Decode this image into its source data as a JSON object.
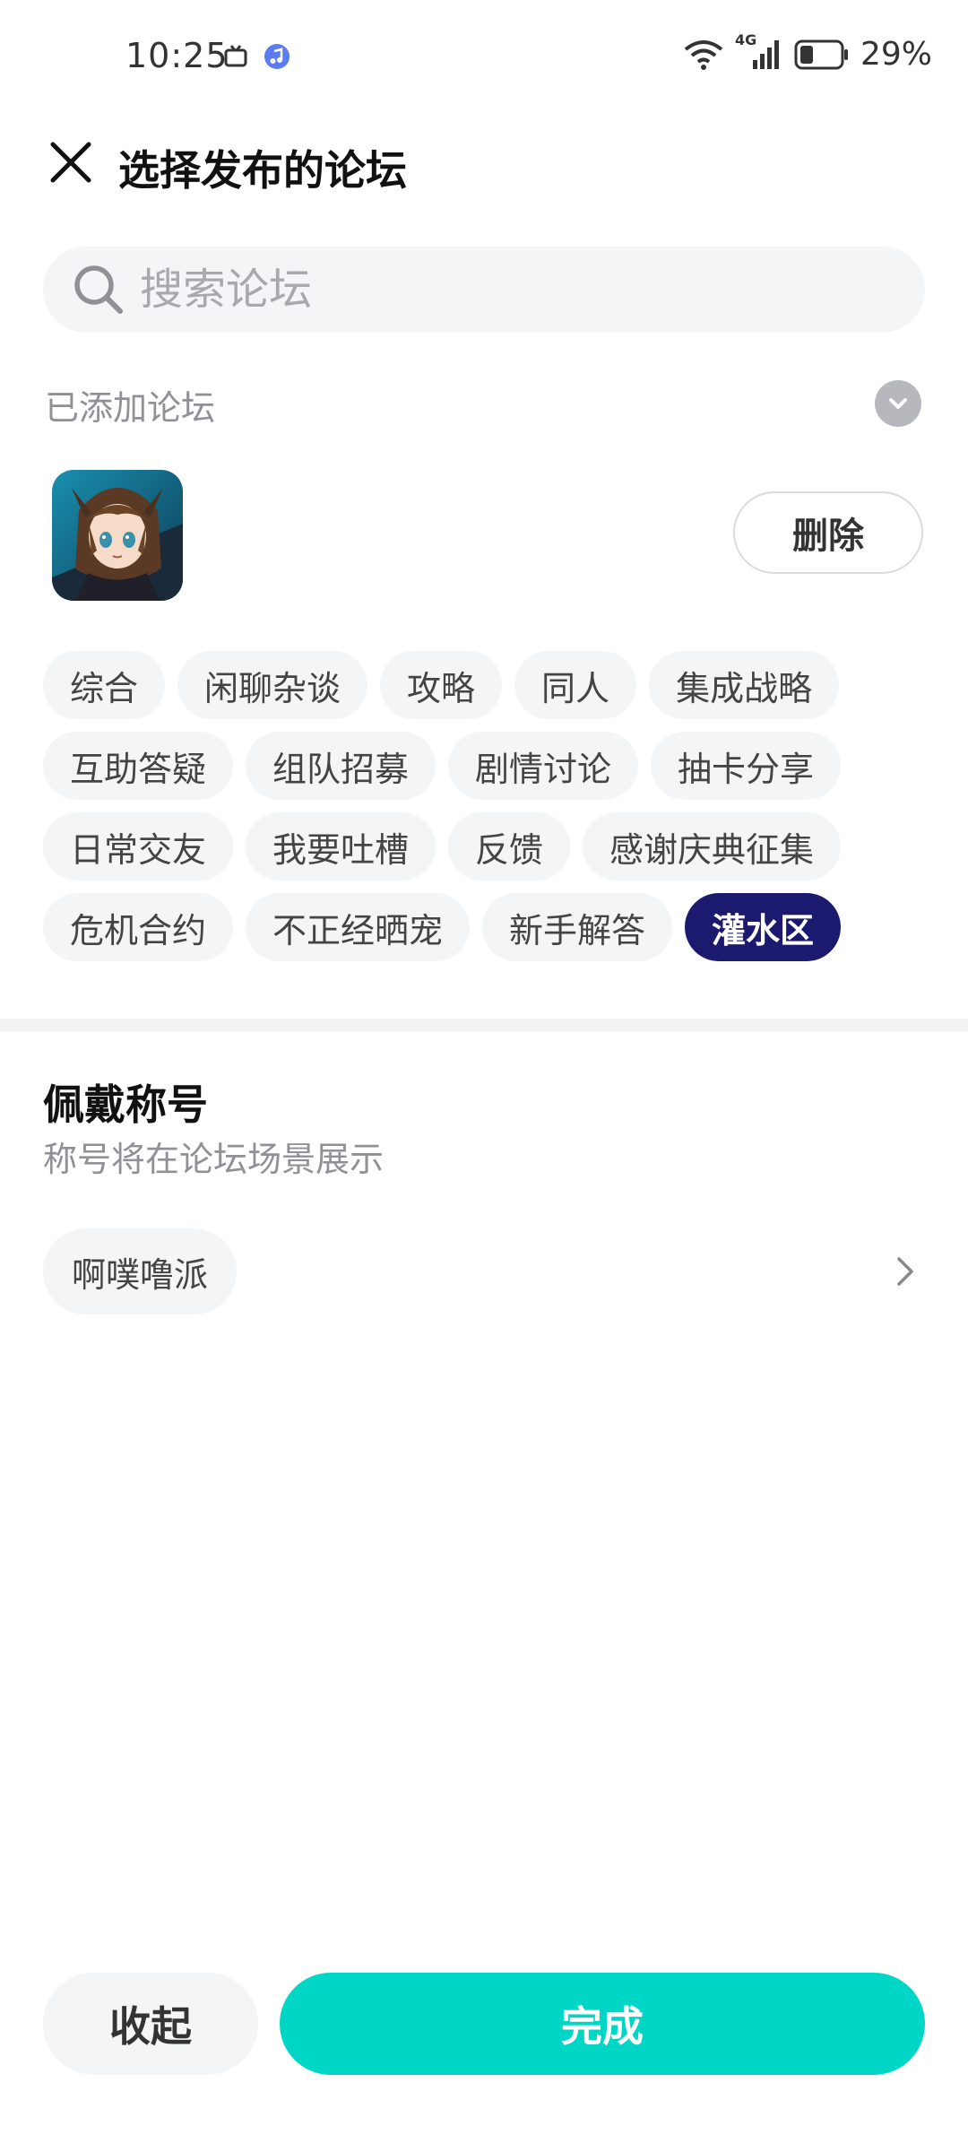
{
  "status_bar": {
    "time": "10:25",
    "network": "4G",
    "battery": "29%",
    "icons": [
      "tv-icon",
      "music-icon",
      "wifi-icon",
      "signal-icon",
      "battery-icon"
    ]
  },
  "header": {
    "title": "选择发布的论坛",
    "close_icon": "close-icon"
  },
  "search": {
    "placeholder": "搜索论坛",
    "value": ""
  },
  "added_forums": {
    "label": "已添加论坛",
    "delete_label": "删除",
    "avatar_icon": "forum-avatar-anime-girl"
  },
  "tags": {
    "rows": [
      [
        "综合",
        "闲聊杂谈",
        "攻略",
        "同人",
        "集成战略"
      ],
      [
        "互助答疑",
        "组队招募",
        "剧情讨论",
        "抽卡分享"
      ],
      [
        "日常交友",
        "我要吐槽",
        "反馈",
        "感谢庆典征集"
      ],
      [
        "危机合约",
        "不正经晒宠",
        "新手解答",
        "灌水区"
      ]
    ],
    "selected": "灌水区",
    "selected_color": "#1c1a6e"
  },
  "title_section": {
    "heading": "佩戴称号",
    "subtitle": "称号将在论坛场景展示",
    "current_title": "啊噗噜派"
  },
  "actions": {
    "collapse_label": "收起",
    "done_label": "完成",
    "done_color": "#00d6c6"
  }
}
